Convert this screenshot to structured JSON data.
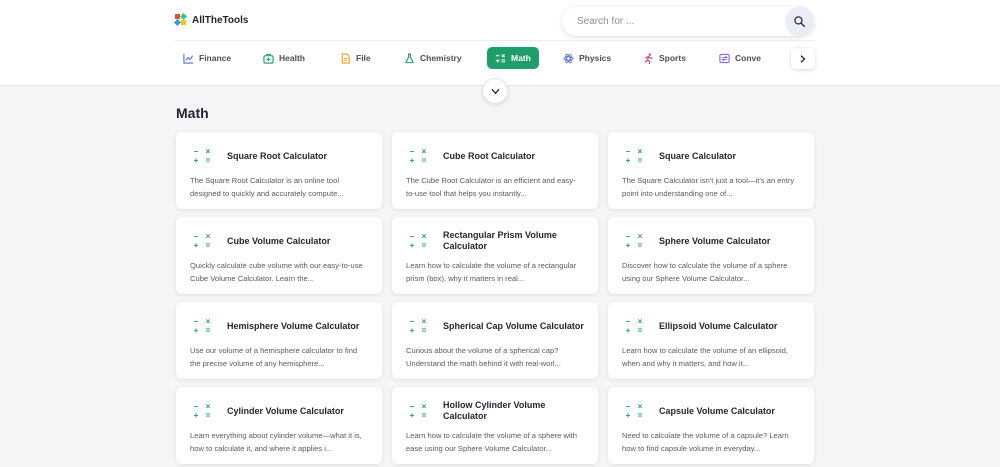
{
  "brand": {
    "name": "AllTheTools",
    "colors": [
      "#e74c3c",
      "#2ecc71",
      "#3498db",
      "#f1c40f"
    ]
  },
  "search": {
    "placeholder": "Search for ...",
    "icon": "search-icon"
  },
  "nav": {
    "items": [
      {
        "label": "Finance",
        "icon": "chart-icon",
        "active": false
      },
      {
        "label": "Health",
        "icon": "medical-kit-icon",
        "active": false
      },
      {
        "label": "File",
        "icon": "file-icon",
        "active": false
      },
      {
        "label": "Chemistry",
        "icon": "flask-icon",
        "active": false
      },
      {
        "label": "Math",
        "icon": "math-operators-icon",
        "active": true
      },
      {
        "label": "Physics",
        "icon": "atom-icon",
        "active": false
      },
      {
        "label": "Sports",
        "icon": "runner-icon",
        "active": false
      },
      {
        "label": "Conve",
        "icon": "convert-icon",
        "active": false
      }
    ],
    "next_icon": "chevron-right-icon",
    "accent": "#1f9d6b"
  },
  "collapse_icon": "chevron-down-icon",
  "section": {
    "title": "Math"
  },
  "cards": [
    {
      "title": "Square Root Calculator",
      "desc": "The Square Root Calculator is an online tool designed to quickly and accurately compute..."
    },
    {
      "title": "Cube Root Calculator",
      "desc": "The Cube Root Calculator is an efficient and easy-to-use tool that helps you instantly..."
    },
    {
      "title": "Square Calculator",
      "desc": "The Square Calculator isn't just a tool—it's an entry point into understanding one of..."
    },
    {
      "title": "Cube Volume Calculator",
      "desc": "Quickly calculate cube volume with our easy-to-use Cube Volume Calculator. Learn the..."
    },
    {
      "title": "Rectangular Prism Volume Calculator",
      "desc": "Learn how to calculate the volume of a rectangular prism (box), why it matters in real..."
    },
    {
      "title": "Sphere Volume Calculator",
      "desc": "Discover how to calculate the volume of a sphere using our Sphere Volume Calculator..."
    },
    {
      "title": "Hemisphere Volume Calculator",
      "desc": "Use our volume of a hemisphere calculator to find the precise volume of any hemisphere..."
    },
    {
      "title": "Spherical Cap Volume Calculator",
      "desc": "Curious about the volume of a spherical cap? Understand the math behind it with real-worl..."
    },
    {
      "title": "Ellipsoid Volume Calculator",
      "desc": "Learn how to calculate the volume of an ellipsoid, when and why it matters, and how it..."
    },
    {
      "title": "Cylinder Volume Calculator",
      "desc": "Learn everything about cylinder volume—what it is, how to calculate it, and where it applies i..."
    },
    {
      "title": "Hollow Cylinder Volume Calculator",
      "desc": "Learn how to calculate the volume of a sphere with ease using our Sphere Volume Calculator..."
    },
    {
      "title": "Capsule Volume Calculator",
      "desc": "Need to calculate the volume of a capsule? Learn how to find capsule volume in everyday..."
    }
  ],
  "card_icon": {
    "name": "math-operators-icon",
    "glyphs": [
      "−",
      "×",
      "+",
      "="
    ]
  }
}
